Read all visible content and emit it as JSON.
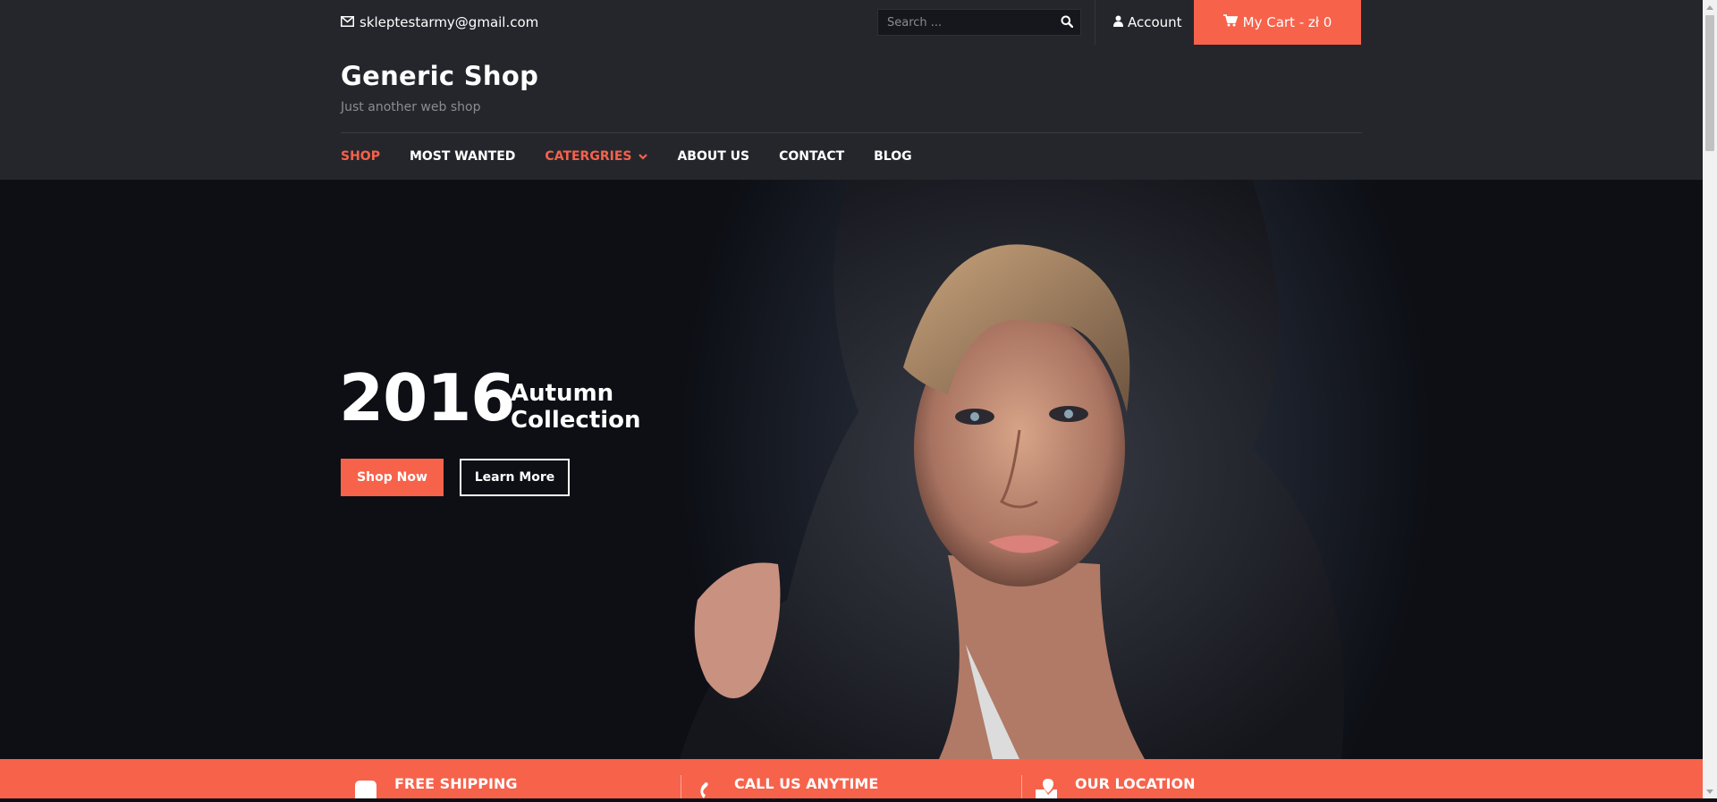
{
  "topbar": {
    "email": "skleptestarmy@gmail.com",
    "search_placeholder": "Search ...",
    "account_label": "Account",
    "cart_label": "My Cart - zł 0"
  },
  "header": {
    "site_title": "Generic Shop",
    "tagline": "Just another web shop"
  },
  "nav": {
    "items": [
      {
        "label": "SHOP",
        "active": true
      },
      {
        "label": "MOST WANTED",
        "active": false
      },
      {
        "label": "CATERGRIES",
        "active": true,
        "has_dropdown": true
      },
      {
        "label": "ABOUT US",
        "active": false
      },
      {
        "label": "CONTACT",
        "active": false
      },
      {
        "label": "BLOG",
        "active": false
      }
    ]
  },
  "hero": {
    "year": "2016",
    "subtitle_line1": "Autumn",
    "subtitle_line2": "Collection",
    "shop_now_label": "Shop Now",
    "learn_more_label": "Learn More"
  },
  "features": [
    {
      "title": "FREE SHIPPING",
      "icon": "truck-icon"
    },
    {
      "title": "CALL US ANYTIME",
      "icon": "phone-icon"
    },
    {
      "title": "OUR LOCATION",
      "icon": "location-icon"
    }
  ],
  "colors": {
    "accent": "#f7624b",
    "topbar_bg": "#25262c",
    "hero_bg": "#0d0e13"
  }
}
